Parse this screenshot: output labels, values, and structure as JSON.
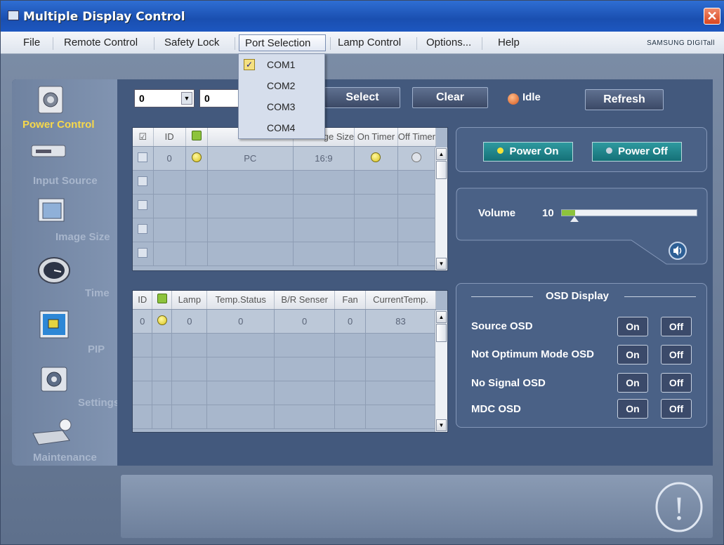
{
  "window": {
    "title": "Multiple Display Control",
    "close_glyph": "✕"
  },
  "menu": {
    "items": [
      "File",
      "Remote Control",
      "Safety Lock",
      "Port Selection",
      "Lamp Control",
      "Options...",
      "Help"
    ],
    "brand": "SAMSUNG DIGITall"
  },
  "port_menu": {
    "options": [
      "COM1",
      "COM2",
      "COM3",
      "COM4"
    ],
    "selected": "COM1",
    "check_glyph": "✓"
  },
  "sidebar": {
    "items": [
      {
        "label": "Power Control",
        "icon": "power-control-icon",
        "active": true
      },
      {
        "label": "Input Source",
        "icon": "input-source-icon"
      },
      {
        "label": "Image Size",
        "icon": "image-size-icon"
      },
      {
        "label": "Time",
        "icon": "time-icon"
      },
      {
        "label": "PIP",
        "icon": "pip-icon"
      },
      {
        "label": "Settings",
        "icon": "settings-icon"
      },
      {
        "label": "Maintenance",
        "icon": "maintenance-icon"
      }
    ]
  },
  "toolbar": {
    "combo1_value": "0",
    "combo2_value": "0",
    "select_label": "Select",
    "clear_label": "Clear",
    "status": "Idle",
    "refresh_label": "Refresh"
  },
  "display_grid": {
    "headers": [
      "ID",
      "ge Size",
      "On Timer",
      "Off Timer"
    ],
    "header_check_glyph": "☑",
    "row": {
      "id": "0",
      "input": "PC",
      "image_size": "16:9"
    }
  },
  "status_grid": {
    "headers": [
      "ID",
      "Lamp",
      "Temp.Status",
      "B/R Senser",
      "Fan",
      "CurrentTemp."
    ],
    "row": {
      "id": "0",
      "lamp": "0",
      "temp_status": "0",
      "br_sensor": "0",
      "fan": "0",
      "current_temp": "83"
    }
  },
  "power": {
    "on_label": "Power On",
    "off_label": "Power Off"
  },
  "volume": {
    "label": "Volume",
    "value": "10",
    "level": 0.1
  },
  "osd": {
    "title": "OSD Display",
    "rows": [
      {
        "label": "Source OSD",
        "on": "On",
        "off": "Off"
      },
      {
        "label": "Not Optimum Mode OSD",
        "on": "On",
        "off": "Off"
      },
      {
        "label": "No Signal OSD",
        "on": "On",
        "off": "Off"
      },
      {
        "label": "MDC OSD",
        "on": "On",
        "off": "Off"
      }
    ]
  },
  "glyphs": {
    "scroll_up": "▲",
    "scroll_down": "▼",
    "combo_arrow": "▼",
    "info": "!"
  }
}
